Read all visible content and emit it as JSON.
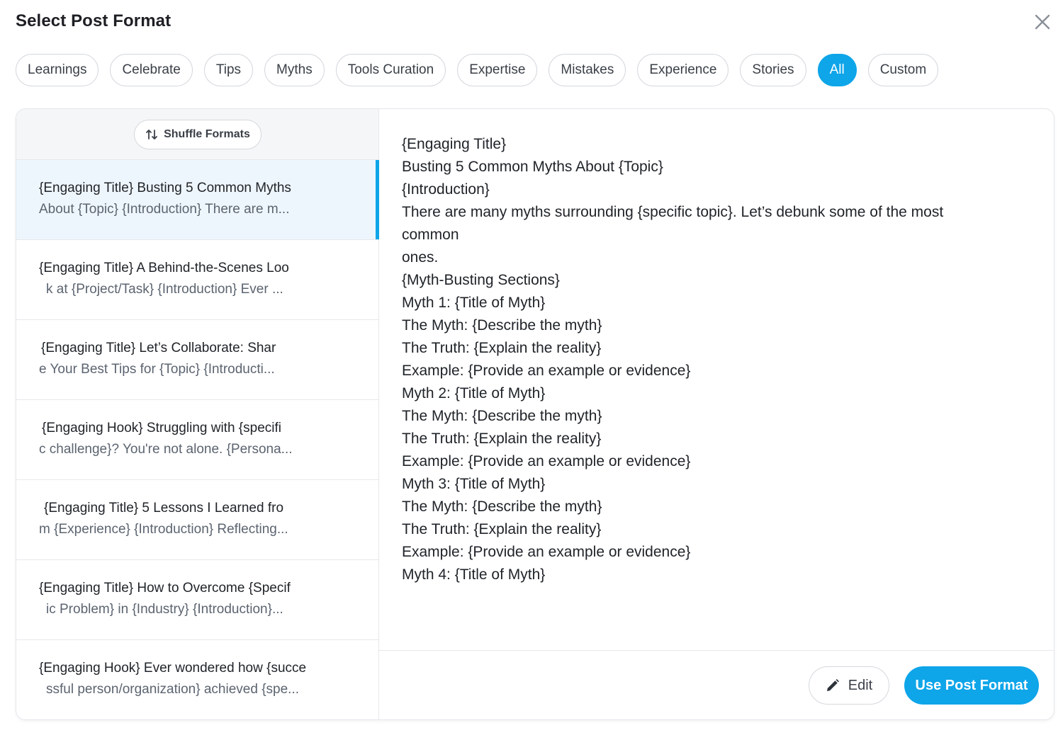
{
  "modal": {
    "title": "Select Post Format"
  },
  "chips": [
    {
      "label": "Learnings",
      "active": false
    },
    {
      "label": "Celebrate",
      "active": false
    },
    {
      "label": "Tips",
      "active": false
    },
    {
      "label": "Myths",
      "active": false
    },
    {
      "label": "Tools Curation",
      "active": false
    },
    {
      "label": "Expertise",
      "active": false
    },
    {
      "label": "Mistakes",
      "active": false
    },
    {
      "label": "Experience",
      "active": false
    },
    {
      "label": "Stories",
      "active": false
    },
    {
      "label": "All",
      "active": true
    },
    {
      "label": "Custom",
      "active": false
    }
  ],
  "shuffle": {
    "label": "Shuffle Formats",
    "icon": "shuffle-arrows-icon"
  },
  "formats": [
    {
      "line1": "{Engaging Title} Busting 5 Common Myths",
      "line2": "About {Topic} {Introduction} There are m...",
      "selected": true
    },
    {
      "line1": "{Engaging Title} A Behind-the-Scenes Loo",
      "line2": "k at {Project/Task} {Introduction} Ever ...",
      "selected": false
    },
    {
      "line1": "{Engaging Title} Let’s Collaborate: Shar",
      "line2": "e Your Best Tips for {Topic} {Introducti...",
      "selected": false
    },
    {
      "line1": "{Engaging Hook} Struggling with {specifi",
      "line2": "c challenge}? You're not alone. {Persona...",
      "selected": false
    },
    {
      "line1": "{Engaging Title} 5 Lessons I Learned fro",
      "line2": "m {Experience} {Introduction} Reflecting...",
      "selected": false
    },
    {
      "line1": "{Engaging Title} How to Overcome {Specif",
      "line2": "ic Problem} in {Industry} {Introduction}...",
      "selected": false
    },
    {
      "line1": "{Engaging Hook} Ever wondered how {succe",
      "line2": "ssful person/organization} achieved {spe...",
      "selected": false
    }
  ],
  "preview": {
    "lines": [
      "{Engaging Title}",
      "Busting 5 Common Myths About {Topic}",
      "{Introduction}",
      "There are many myths surrounding {specific topic}. Let’s debunk some of the most",
      "common",
      "ones.",
      "{Myth-Busting Sections}",
      "Myth 1: {Title of Myth}",
      "The Myth: {Describe the myth}",
      "The Truth: {Explain the reality}",
      "Example: {Provide an example or evidence}",
      "Myth 2: {Title of Myth}",
      "The Myth: {Describe the myth}",
      "The Truth: {Explain the reality}",
      "Example: {Provide an example or evidence}",
      "Myth 3: {Title of Myth}",
      "The Myth: {Describe the myth}",
      "The Truth: {Explain the reality}",
      "Example: {Provide an example or evidence}",
      "Myth 4: {Title of Myth}"
    ]
  },
  "footer": {
    "edit_label": "Edit",
    "edit_icon": "pencil-icon",
    "use_label": "Use Post Format"
  },
  "colors": {
    "accent": "#0ea5e9",
    "selected_bg": "#eef6fd",
    "border": "#d5d8dd"
  }
}
